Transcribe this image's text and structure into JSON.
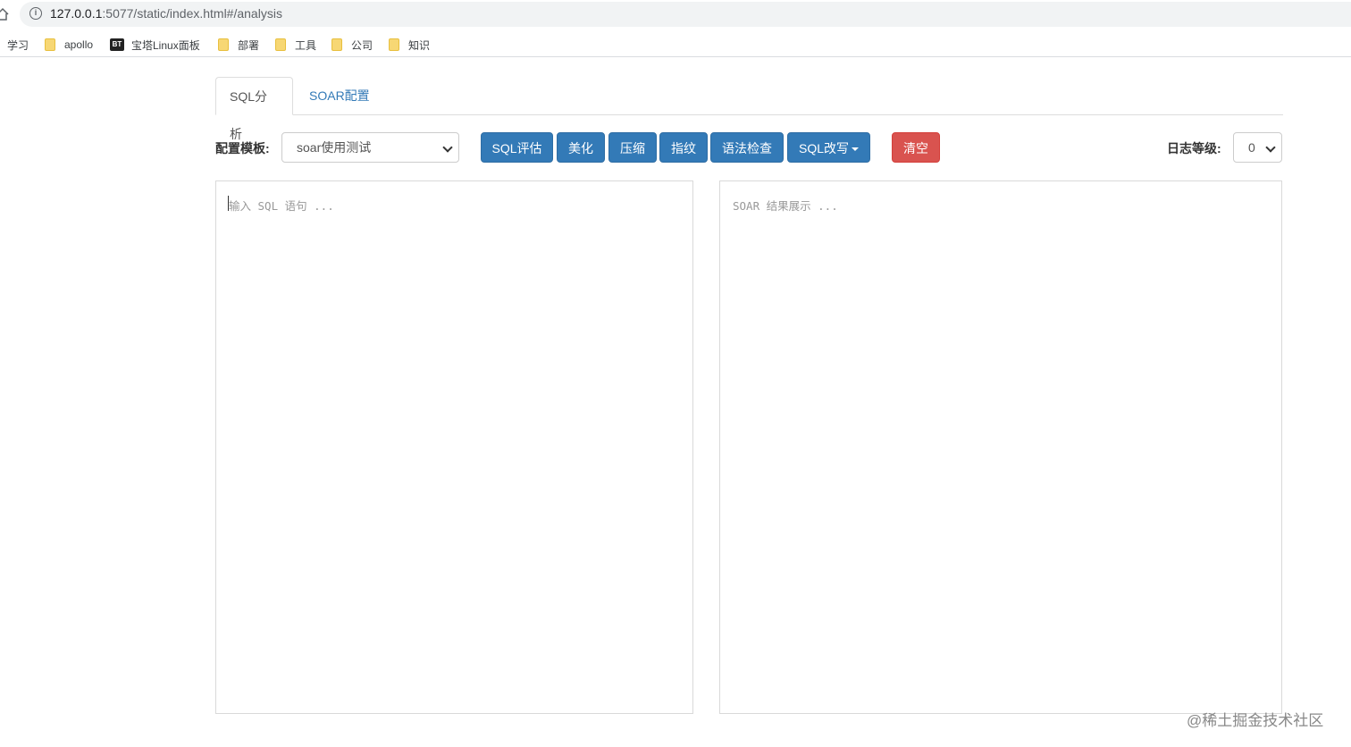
{
  "browser": {
    "url_prefix": "127.0.0.1",
    "url_rest": ":5077/static/index.html#/analysis",
    "bookmarks": [
      {
        "label": "学习",
        "icon": "none"
      },
      {
        "label": "apollo",
        "icon": "folder-icon"
      },
      {
        "label": "宝塔Linux面板",
        "icon": "bt-icon",
        "badge": "BT"
      },
      {
        "label": "部署",
        "icon": "folder-icon"
      },
      {
        "label": "工具",
        "icon": "folder-icon"
      },
      {
        "label": "公司",
        "icon": "folder-icon"
      },
      {
        "label": "知识",
        "icon": "folder-icon"
      }
    ]
  },
  "tabs": [
    {
      "label": "SQL分析",
      "active": true
    },
    {
      "label": "SOAR配置",
      "active": false
    }
  ],
  "toolbar": {
    "template_label": "配置模板:",
    "template_value": "soar使用测试",
    "buttons": {
      "evaluate": "SQL评估",
      "beautify": "美化",
      "compress": "压缩",
      "fingerprint": "指纹",
      "syntax_check": "语法检查",
      "rewrite": "SQL改写",
      "clear": "清空"
    },
    "log_level_label": "日志等级:",
    "log_level_value": "0"
  },
  "editor": {
    "input_placeholder": "输入 SQL 语句 ...",
    "output_placeholder": "SOAR 结果展示 ..."
  },
  "watermark": "@稀土掘金技术社区",
  "colors": {
    "primary": "#337ab7",
    "danger": "#d9534f",
    "link": "#337ab7"
  }
}
